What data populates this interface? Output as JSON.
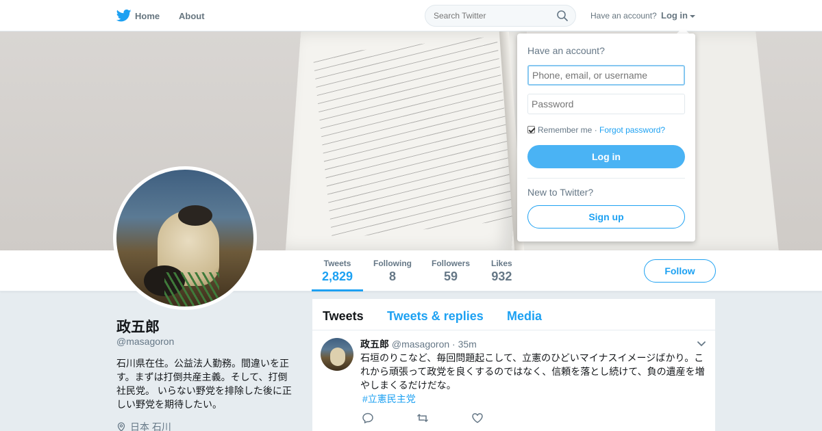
{
  "colors": {
    "accent": "#1da1f2",
    "login_button": "#4ab3f4",
    "page_bg": "#e6ecf0",
    "muted": "#657786"
  },
  "icons": {
    "logo": "twitter-bird-icon",
    "search": "search-icon",
    "location": "location-pin-icon",
    "reply": "reply-icon",
    "retweet": "retweet-icon",
    "like": "heart-icon",
    "caret": "chevron-down-icon"
  },
  "nav": {
    "home_label": "Home",
    "about_label": "About",
    "search_placeholder": "Search Twitter",
    "have_account": "Have an account?",
    "login_label": "Log in"
  },
  "login_dropdown": {
    "heading": "Have an account?",
    "username_placeholder": "Phone, email, or username",
    "password_placeholder": "Password",
    "remember_label": "Remember me",
    "separator": "·",
    "forgot_label": "Forgot password?",
    "login_button": "Log in",
    "new_heading": "New to Twitter?",
    "signup_button": "Sign up"
  },
  "profile": {
    "name": "政五郎",
    "handle": "@masagoron",
    "bio": "石川県在住。公益法人勤務。間違いを正す。まずは打倒共産主義。そして、打倒社民党。 いらない野党を排除した後に正しい野党を期待したい。",
    "location": "日本 石川",
    "follow_label": "Follow"
  },
  "stats": [
    {
      "label": "Tweets",
      "value": "2,829"
    },
    {
      "label": "Following",
      "value": "8"
    },
    {
      "label": "Followers",
      "value": "59"
    },
    {
      "label": "Likes",
      "value": "932"
    }
  ],
  "timeline": {
    "tabs": [
      "Tweets",
      "Tweets & replies",
      "Media"
    ],
    "tweet": {
      "name": "政五郎",
      "handle": "@masagoron",
      "dot": "·",
      "time": "35m",
      "text": "石垣のりこなど、毎回問題起こして、立憲のひどいマイナスイメージばかり。これから頑張って政党を良くするのではなく、信頼を落とし続けて、負の遺産を増やしまくるだけだな。",
      "hashtag": "#立憲民主党"
    }
  }
}
